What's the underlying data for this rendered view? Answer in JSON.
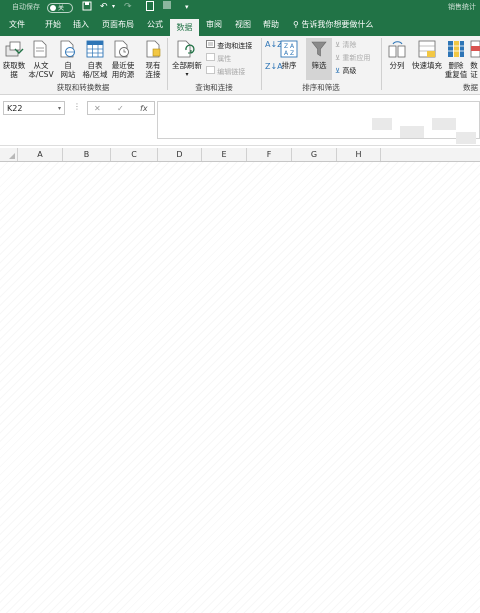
{
  "titlebar": {
    "autosave_label": "自动保存",
    "autosave_state": "关",
    "doc_title": "销售统计",
    "qa_icons": [
      "save-icon",
      "undo-icon",
      "redo-icon",
      "form-icon",
      "customize-icon"
    ]
  },
  "tabs": [
    {
      "label": "文件",
      "active": false
    },
    {
      "label": "开始",
      "active": false
    },
    {
      "label": "插入",
      "active": false
    },
    {
      "label": "页面布局",
      "active": false
    },
    {
      "label": "公式",
      "active": false
    },
    {
      "label": "数据",
      "active": true
    },
    {
      "label": "审阅",
      "active": false
    },
    {
      "label": "视图",
      "active": false
    },
    {
      "label": "帮助",
      "active": false
    }
  ],
  "tellme": {
    "label": "告诉我你想要做什么"
  },
  "ribbon": {
    "get_transform": {
      "get_data": "获取数\n据",
      "from_csv": "从文\n本/CSV",
      "from_web": "自\n网站",
      "from_table": "自表\n格/区域",
      "recent_sources": "最近使\n用的源",
      "existing_connections": "现有\n连接",
      "label": "获取和转换数据"
    },
    "queries": {
      "refresh_all": "全部刷新",
      "queries_connections": "查询和连接",
      "properties": "属性",
      "edit_links": "编辑链接",
      "label": "查询和连接"
    },
    "sort_filter": {
      "sort": "排序",
      "filter": "筛选",
      "clear": "清除",
      "reapply": "重新应用",
      "advanced": "高级",
      "label": "排序和筛选"
    },
    "data_tools": {
      "text_to_columns": "分列",
      "flash_fill": "快速填充",
      "remove_duplicates": "删除\n重复值",
      "data_validation": "数\n证",
      "label": "数据"
    }
  },
  "formula_bar": {
    "name_box": "K22",
    "cancel_symbol": "✕",
    "enter_symbol": "✓",
    "fx_symbol": "fx",
    "formula": ""
  },
  "columns": [
    "A",
    "B",
    "C",
    "D",
    "E",
    "F",
    "G",
    "H"
  ],
  "colors": {
    "excel_green": "#217346",
    "ribbon_bg": "#f3f3f3"
  }
}
